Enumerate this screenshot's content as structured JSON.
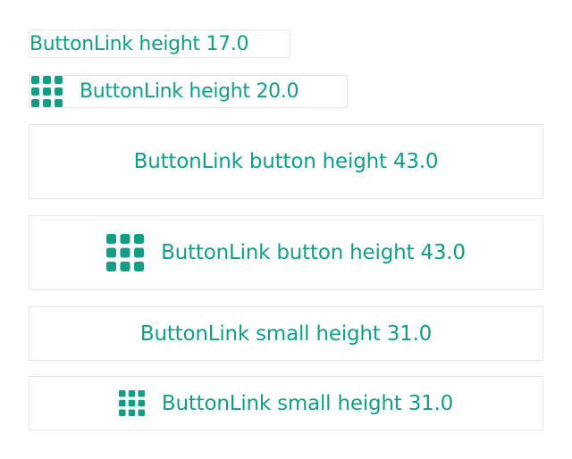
{
  "accent_color": "#119e85",
  "border_color": "#e6e6e6",
  "links": [
    {
      "label": "ButtonLink height 17.0",
      "icon": null
    },
    {
      "label": "ButtonLink height 20.0",
      "icon": "grid-icon"
    },
    {
      "label": "ButtonLink button height 43.0",
      "icon": null
    },
    {
      "label": "ButtonLink button height 43.0",
      "icon": "grid-icon"
    },
    {
      "label": "ButtonLink small height 31.0",
      "icon": null
    },
    {
      "label": "ButtonLink small height 31.0",
      "icon": "grid-icon"
    }
  ]
}
